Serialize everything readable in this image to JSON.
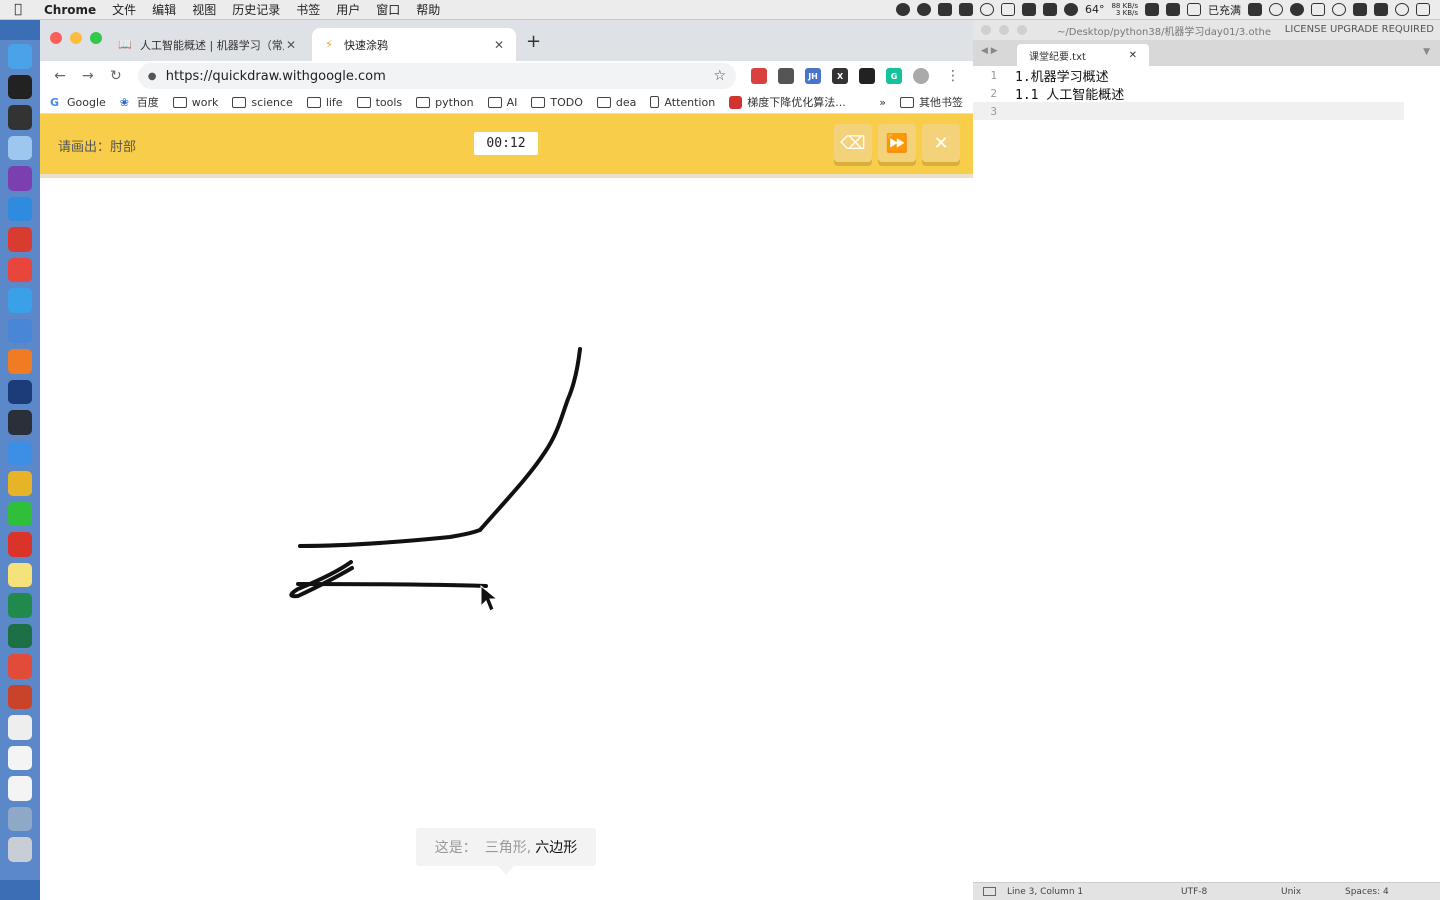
{
  "menubar": {
    "app_name": "Chrome",
    "items": [
      "文件",
      "编辑",
      "视图",
      "历史记录",
      "书签",
      "用户",
      "窗口",
      "帮助"
    ],
    "status_items": {
      "temperature": "64°",
      "net_up": "88 KB/s",
      "net_down": "3 KB/s",
      "battery_text": "已充满"
    }
  },
  "chrome": {
    "tabs": [
      {
        "title": "人工智能概述 | 机器学习（常用...",
        "active": false
      },
      {
        "title": "快速涂鸦",
        "active": true
      }
    ],
    "new_tab_symbol": "+",
    "url": "https://quickdraw.withgoogle.com",
    "bookmarks": [
      {
        "label": "Google",
        "icon": "google-icon"
      },
      {
        "label": "百度",
        "icon": "baidu-icon"
      },
      {
        "label": "work",
        "icon": "folder-icon"
      },
      {
        "label": "science",
        "icon": "folder-icon"
      },
      {
        "label": "life",
        "icon": "folder-icon"
      },
      {
        "label": "tools",
        "icon": "folder-icon"
      },
      {
        "label": "python",
        "icon": "folder-icon"
      },
      {
        "label": "AI",
        "icon": "folder-icon"
      },
      {
        "label": "TODO",
        "icon": "folder-icon"
      },
      {
        "label": "dea",
        "icon": "folder-icon"
      },
      {
        "label": "Attention",
        "icon": "page-icon"
      },
      {
        "label": "梯度下降优化算法...",
        "icon": "csdn-icon"
      }
    ],
    "bookmarks_more": "»",
    "other_bookmarks": "其他书签",
    "extensions": [
      {
        "name": "ext-red-icon",
        "color": "#d94040",
        "text": ""
      },
      {
        "name": "bookmark-ribbon-icon",
        "color": "#555555",
        "text": ""
      },
      {
        "name": "jh-icon",
        "color": "#4a74c9",
        "text": "JH"
      },
      {
        "name": "x-ext-icon",
        "color": "#333333",
        "text": "X"
      },
      {
        "name": "incognito-ext-icon",
        "color": "#222222",
        "text": ""
      },
      {
        "name": "grammarly-icon",
        "color": "#15c39a",
        "text": "G"
      },
      {
        "name": "profile-avatar-icon",
        "color": "#aaaaaa",
        "text": ""
      }
    ]
  },
  "quickdraw": {
    "prompt": "请画出：肘部",
    "timer": "00:12",
    "buttons": {
      "clear": "eraser-icon",
      "skip": "fast-forward-icon",
      "close": "close-icon"
    },
    "guess_prefix": "这是：",
    "guess_previous": "三角形,",
    "guess_current": "六边形"
  },
  "sublime": {
    "title": "~/Desktop/python38/机器学习day01/3.othe",
    "license": "LICENSE UPGRADE REQUIRED",
    "tab_name": "课堂纪要.txt",
    "lines": [
      {
        "num": "1",
        "text": "1.机器学习概述"
      },
      {
        "num": "2",
        "text": "1.1 人工智能概述"
      },
      {
        "num": "3",
        "text": ""
      }
    ],
    "status": {
      "position": "Line 3, Column 1",
      "encoding": "UTF-8",
      "line_endings": "Unix",
      "indent": "Spaces: 4"
    }
  },
  "dock": {
    "apps": [
      {
        "name": "finder-icon",
        "color": "#4aa3e8"
      },
      {
        "name": "terminal-icon",
        "color": "#222222"
      },
      {
        "name": "obs-icon",
        "color": "#333333"
      },
      {
        "name": "app-store-icon",
        "color": "#9ec7f0"
      },
      {
        "name": "onenote-icon",
        "color": "#7b3fb0"
      },
      {
        "name": "maps-icon",
        "color": "#2f8be0"
      },
      {
        "name": "wps-icon",
        "color": "#d83b2f"
      },
      {
        "name": "git-client-icon",
        "color": "#e8463c"
      },
      {
        "name": "pen-app-icon",
        "color": "#3aa0e8"
      },
      {
        "name": "window-manager-icon",
        "color": "#4a86d8"
      },
      {
        "name": "sublime-text-icon",
        "color": "#f07b22"
      },
      {
        "name": "quicktime-icon",
        "color": "#1b3c78"
      },
      {
        "name": "activity-monitor-icon",
        "color": "#2a2f3a"
      },
      {
        "name": "safari-icon",
        "color": "#3d8fe6"
      },
      {
        "name": "chrome-icon",
        "color": "#e8b427"
      },
      {
        "name": "wechat-icon",
        "color": "#2fbf3b"
      },
      {
        "name": "netease-music-icon",
        "color": "#d9332a"
      },
      {
        "name": "notes-icon",
        "color": "#f5e27a"
      },
      {
        "name": "pycharm-icon",
        "color": "#1f8a4c"
      },
      {
        "name": "excel-icon",
        "color": "#1d7045"
      },
      {
        "name": "xmind-icon",
        "color": "#e04b3a"
      },
      {
        "name": "powerpoint-icon",
        "color": "#c9432b"
      },
      {
        "name": "document-icon",
        "color": "#eeeeee"
      },
      {
        "name": "file-icon",
        "color": "#f4f4f4"
      },
      {
        "name": "file-2-icon",
        "color": "#f4f4f4"
      },
      {
        "name": "screen-icon",
        "color": "#90a8c8"
      },
      {
        "name": "trash-icon",
        "color": "#c9ced6"
      }
    ]
  }
}
